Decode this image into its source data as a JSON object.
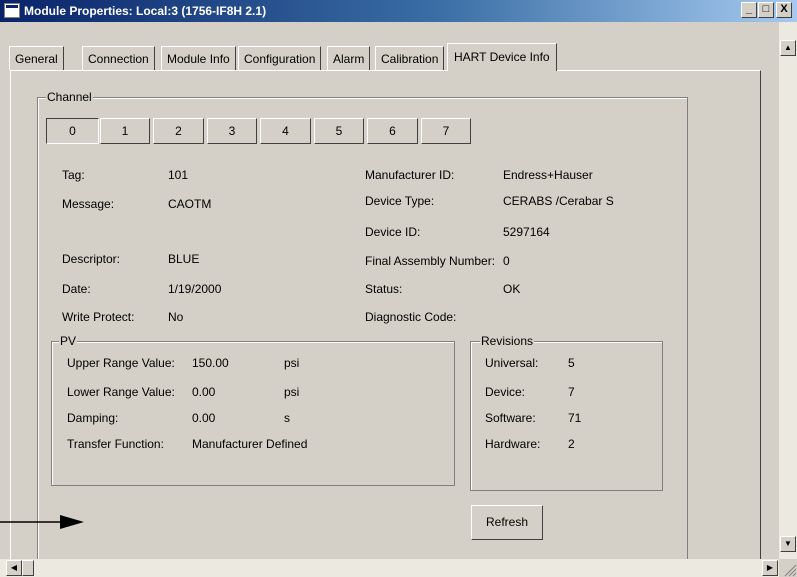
{
  "window": {
    "title": "Module Properties: Local:3 (1756-IF8H 2.1)"
  },
  "caption_buttons": {
    "minimize": "_",
    "maximize": "□",
    "close": "X"
  },
  "tabs": [
    "General",
    "Connection",
    "Module Info",
    "Configuration",
    "Alarm",
    "Calibration",
    "HART Device Info"
  ],
  "active_tab": "HART Device Info",
  "channel": {
    "label": "Channel",
    "buttons": [
      "0",
      "1",
      "2",
      "3",
      "4",
      "5",
      "6",
      "7"
    ],
    "selected": "0"
  },
  "info_left": {
    "tag_label": "Tag:",
    "tag_value": "101",
    "message_label": "Message:",
    "message_value": "CAOTM",
    "descriptor_label": "Descriptor:",
    "descriptor_value": "BLUE",
    "date_label": "Date:",
    "date_value": "1/19/2000",
    "write_protect_label": "Write Protect:",
    "write_protect_value": "No"
  },
  "info_right": {
    "manufacturer_label": "Manufacturer ID:",
    "manufacturer_value": "Endress+Hauser",
    "device_type_label": "Device Type:",
    "device_type_value": "CERABS /Cerabar S",
    "device_id_label": "Device ID:",
    "device_id_value": "5297164",
    "final_assembly_label": "Final Assembly Number:",
    "final_assembly_value": "0",
    "status_label": "Status:",
    "status_value": "OK",
    "diagnostic_label": "Diagnostic Code:",
    "diagnostic_value": ""
  },
  "pv": {
    "label": "PV",
    "upper_label": "Upper Range Value:",
    "upper_value": "150.00",
    "upper_unit": "psi",
    "lower_label": "Lower Range Value:",
    "lower_value": "0.00",
    "lower_unit": "psi",
    "damping_label": "Damping:",
    "damping_value": "0.00",
    "damping_unit": "s",
    "transfer_label": "Transfer Function:",
    "transfer_value": "Manufacturer Defined"
  },
  "revisions": {
    "label": "Revisions",
    "universal_label": "Universal:",
    "universal_value": "5",
    "device_label": "Device:",
    "device_value": "7",
    "software_label": "Software:",
    "software_value": "71",
    "hardware_label": "Hardware:",
    "hardware_value": "2"
  },
  "refresh_button": "Refresh",
  "colors": {
    "face": "#d4d0c8",
    "title_start": "#0a246a",
    "title_end": "#a6caf0"
  }
}
